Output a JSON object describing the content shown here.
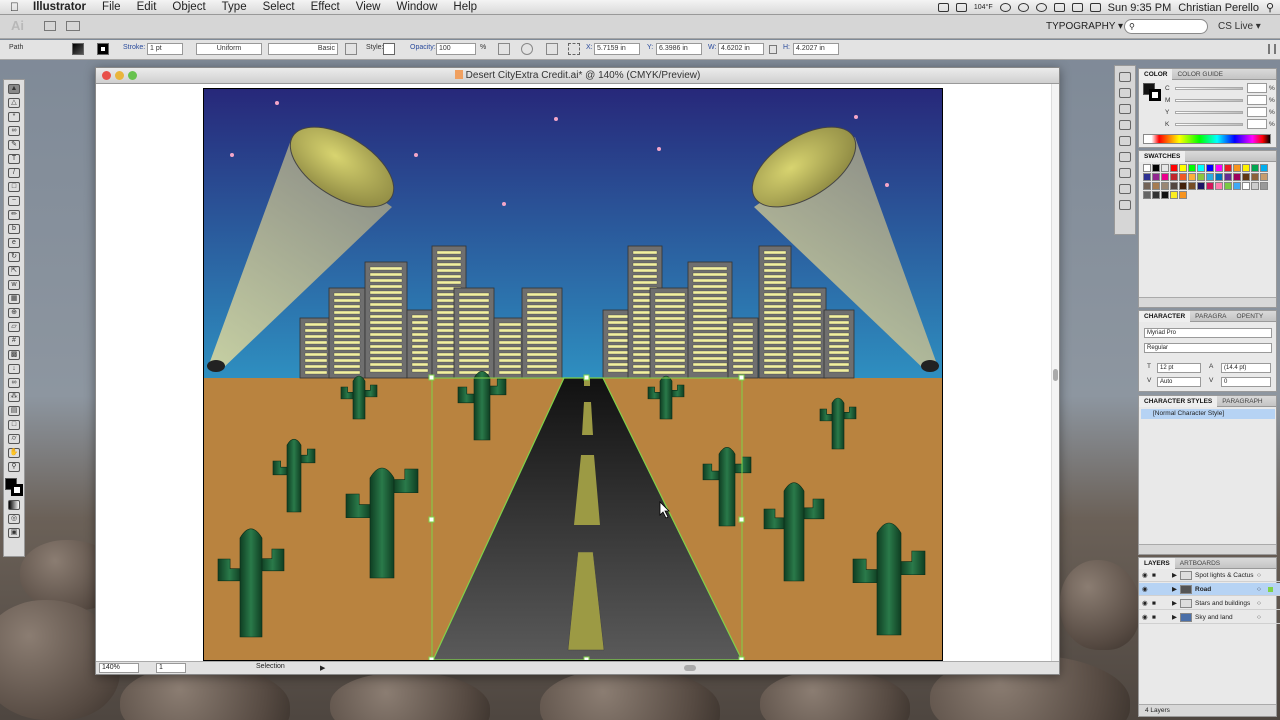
{
  "menubar": {
    "app": "Illustrator",
    "items": [
      "File",
      "Edit",
      "Object",
      "Type",
      "Select",
      "Effect",
      "View",
      "Window",
      "Help"
    ],
    "weather": "104°F",
    "clock": "Sun 9:35 PM",
    "user": "Christian Perello"
  },
  "appbar": {
    "logo": "Ai",
    "workspace": "TYPOGRAPHY ▾",
    "cslive": "CS Live ▾"
  },
  "control": {
    "object_type": "Path",
    "stroke_label": "Stroke:",
    "stroke_weight": "1 pt",
    "profile": "Uniform",
    "brush": "Basic",
    "style_label": "Style:",
    "opacity_label": "Opacity:",
    "opacity_value": "100",
    "opacity_unit": "%",
    "x_label": "X:",
    "x_value": "5.7159 in",
    "y_label": "Y:",
    "y_value": "6.3986 in",
    "w_label": "W:",
    "w_value": "4.6202 in",
    "h_label": "H:",
    "h_value": "4.2027 in"
  },
  "document": {
    "title": "Desert CityExtra Credit.ai* @ 140% (CMYK/Preview)",
    "zoom": "140%",
    "page": "1",
    "status_tool": "Selection"
  },
  "color_panel": {
    "tabs": [
      "COLOR",
      "COLOR GUIDE"
    ],
    "channels": [
      "C",
      "M",
      "Y",
      "K"
    ],
    "unit": "%"
  },
  "swatches_panel": {
    "title": "SWATCHES",
    "colors": [
      "#ffffff",
      "#000000",
      "#e6e6e6",
      "#ff0000",
      "#ffff00",
      "#00ff00",
      "#00ffff",
      "#0000ff",
      "#ff00ff",
      "#ed1c24",
      "#f7941d",
      "#fff200",
      "#00a651",
      "#00aeef",
      "#2e3192",
      "#92278f",
      "#ec008c",
      "#c1272d",
      "#f15a24",
      "#fbb03b",
      "#8cc63f",
      "#29abe2",
      "#0071bc",
      "#662d91",
      "#9e005d",
      "#603813",
      "#8c6239",
      "#c69c6d",
      "#736357",
      "#a67c52",
      "#998675",
      "#534741",
      "#42210b",
      "#754c24",
      "#1b1464",
      "#d4145a",
      "#ff7bac",
      "#7ac943",
      "#3fa9f5",
      "#ffffff",
      "#cccccc",
      "#999999",
      "#666666",
      "#333333",
      "#111111",
      "#fbed21",
      "#f7931e"
    ]
  },
  "character_panel": {
    "tabs": [
      "CHARACTER",
      "PARAGRA",
      "OPENTY"
    ],
    "font_family": "Myriad Pro",
    "font_style": "Regular",
    "font_size": "12 pt",
    "leading": "(14.4 pt)",
    "kerning": "Auto",
    "tracking": "0"
  },
  "char_styles_panel": {
    "tabs": [
      "CHARACTER STYLES",
      "PARAGRAPH"
    ],
    "item": "[Normal Character Style]"
  },
  "layers_panel": {
    "tabs": [
      "LAYERS",
      "ARTBOARDS"
    ],
    "layers": [
      "Spot lights & Cactus",
      "Road",
      "Stars and buildings",
      "Sky and land"
    ],
    "footer": "4 Layers"
  },
  "colors": {
    "sky_top": "#27287a",
    "sky_bottom": "#2e8fc0",
    "ground": "#b9833f",
    "cactus": "#1b5a35",
    "road": "#3a3a3a",
    "road_line": "#9c9a44",
    "building": "#6f6f6f",
    "window": "#f2f0a0",
    "selection": "#7fd34a"
  },
  "icons": {
    "apple": "apple-icon",
    "search": "search-icon",
    "cursor": "arrow-cursor-icon"
  }
}
